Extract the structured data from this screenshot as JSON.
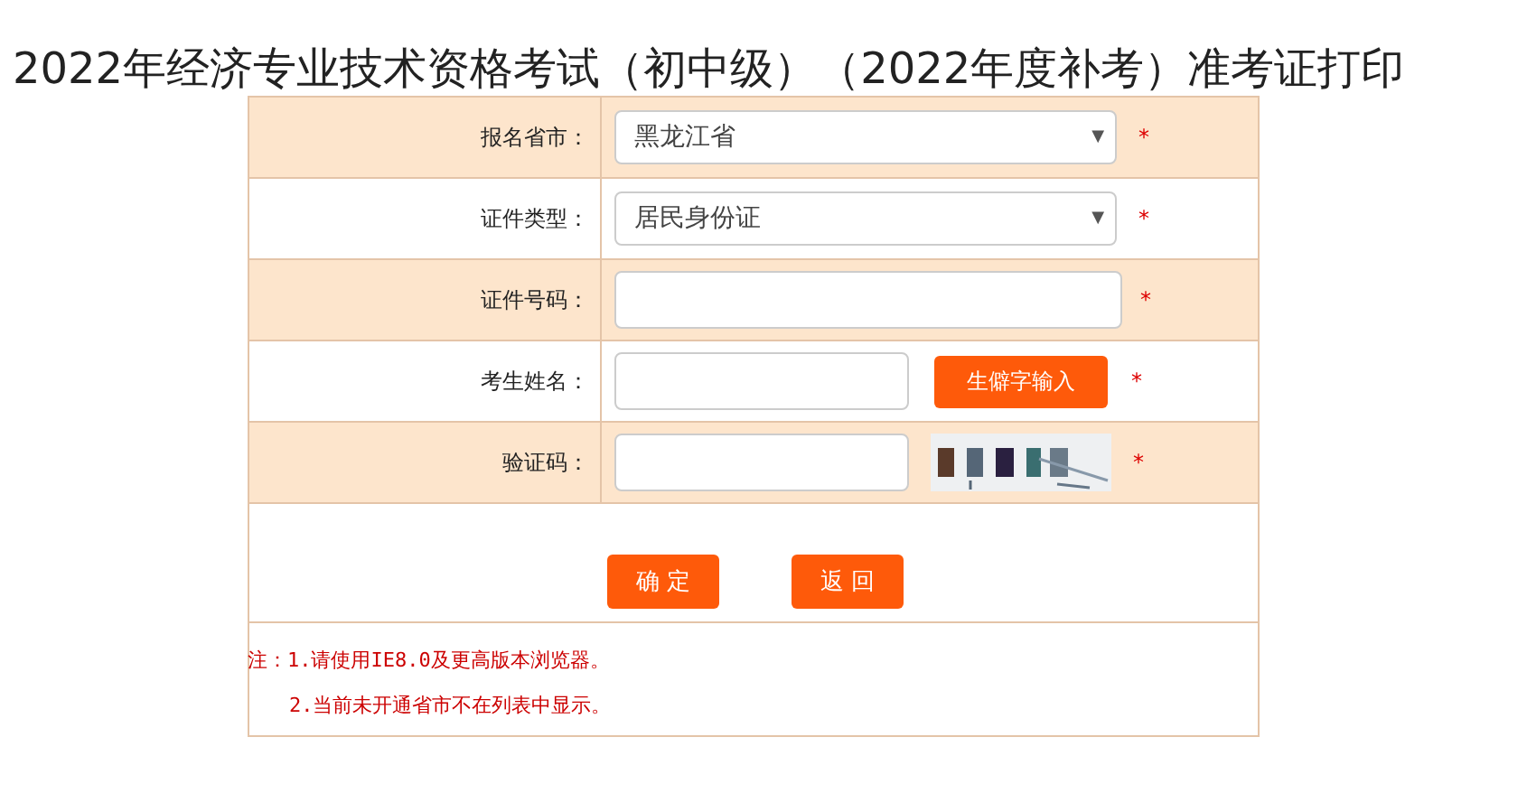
{
  "title": "2022年经济专业技术资格考试（初中级）（2022年度补考）准考证打印",
  "rows": [
    {
      "label": "报名省市：",
      "kind": "select",
      "value": "黑龙江省",
      "caret": "▼",
      "required": "*"
    },
    {
      "label": "证件类型：",
      "kind": "select",
      "value": "居民身份证",
      "caret": "▼",
      "required": "*"
    },
    {
      "label": "证件号码：",
      "kind": "input",
      "required": "*"
    },
    {
      "label": "考生姓名：",
      "kind": "input-button",
      "button": "生僻字输入",
      "required": "*"
    },
    {
      "label": "验证码：",
      "kind": "input-captcha",
      "required": "*"
    }
  ],
  "buttons": [
    "确 定",
    "返 回"
  ],
  "notes": [
    "注：1.请使用IE8.0及更高版本浏览器。",
    "2.当前未开通省市不在列表中显示。"
  ]
}
